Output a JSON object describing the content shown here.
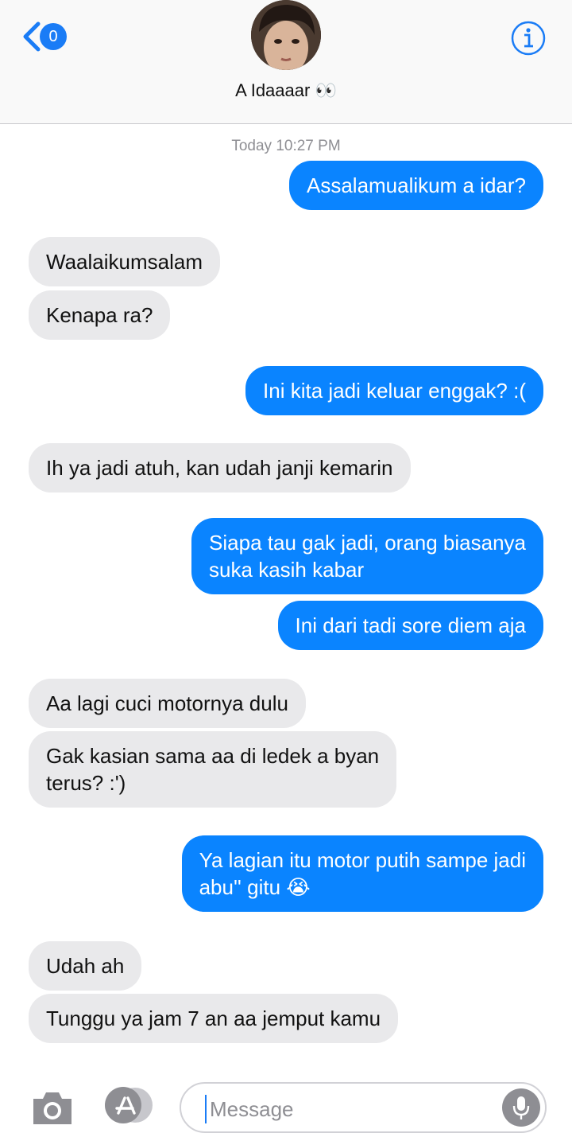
{
  "header": {
    "back_badge_count": "0",
    "contact_name": "A Idaaaar 👀"
  },
  "timestamp": "Today 10:27 PM",
  "messages": [
    {
      "from": "me",
      "text": "Assalamualikum a idar?"
    },
    {
      "from": "them",
      "text": "Waalaikumsalam"
    },
    {
      "from": "them",
      "text": "Kenapa ra?"
    },
    {
      "from": "me",
      "text": "Ini kita jadi keluar enggak? :("
    },
    {
      "from": "them",
      "text": "Ih ya jadi atuh, kan udah janji kemarin"
    },
    {
      "from": "me",
      "text": "Siapa tau gak jadi, orang biasanya\nsuka kasih kabar"
    },
    {
      "from": "me",
      "text": "Ini dari tadi sore diem aja"
    },
    {
      "from": "them",
      "text": "Aa lagi cuci motornya dulu"
    },
    {
      "from": "them",
      "text": "Gak kasian sama aa di ledek a byan\nterus? :')"
    },
    {
      "from": "me",
      "text": "Ya lagian itu motor putih sampe jadi\nabu'' gitu 😭"
    },
    {
      "from": "them",
      "text": "Udah ah"
    },
    {
      "from": "them",
      "text": "Tunggu ya jam 7 an aa jemput kamu"
    }
  ],
  "composer": {
    "placeholder": "Message",
    "value": ""
  },
  "colors": {
    "accent": "#0a84ff",
    "sent_bubble": "#0a84ff",
    "received_bubble": "#e9e9eb",
    "timestamp": "#8e8e93"
  },
  "icons": [
    "back-chevron-icon",
    "info-icon",
    "camera-icon",
    "app-store-icon",
    "microphone-icon"
  ]
}
